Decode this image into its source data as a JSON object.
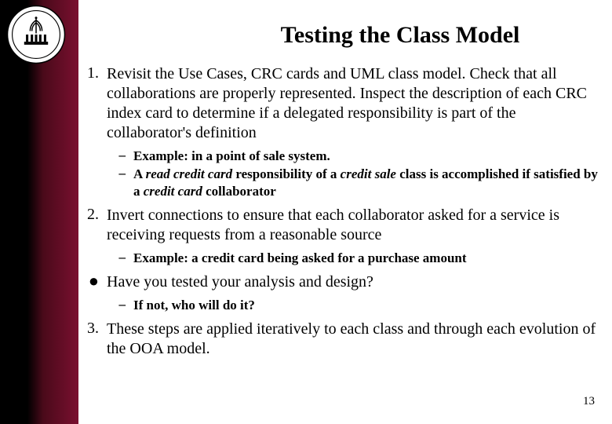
{
  "title": "Testing the Class Model",
  "page_number": "13",
  "items": [
    {
      "marker": "1.",
      "text": "Revisit the Use Cases, CRC cards and UML class model. Check that all collaborations are properly represented. Inspect the description of each CRC index card to determine if a delegated responsibility is part of the collaborator's definition",
      "sub": [
        {
          "marker": "–",
          "prefix": "Example: in a point of sale system.",
          "italic_runs": []
        },
        {
          "marker": "–",
          "prefix": "A ",
          "r1": "read credit card",
          "mid1": " responsibility of a ",
          "r2": "credit sale",
          "mid2": " class is accomplished if satisfied by a ",
          "r3": "credit card",
          "suffix": " collaborator"
        }
      ]
    },
    {
      "marker": "2.",
      "text": "Invert connections to ensure that each collaborator asked for a service is receiving requests from a reasonable source",
      "sub": [
        {
          "marker": "–",
          "prefix": "Example: a credit card being asked for a purchase amount"
        }
      ]
    },
    {
      "marker": "●",
      "text": "Have you tested your analysis and design?",
      "sub": [
        {
          "marker": "–",
          "prefix": "If not, who will do it?"
        }
      ]
    },
    {
      "marker": "3.",
      "text": "These steps are applied iteratively to each class and through each evolution of the OOA model.",
      "sub": []
    }
  ]
}
